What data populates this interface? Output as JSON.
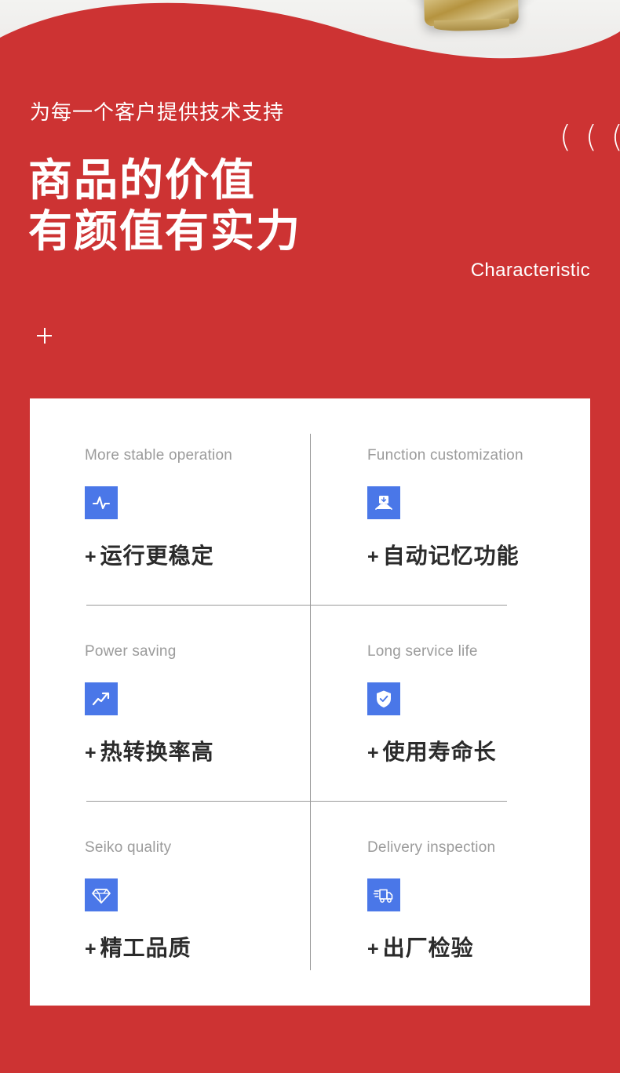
{
  "colors": {
    "brand_red": "#cd3333",
    "icon_blue": "#4a77e8",
    "card_background": "#ffffff",
    "page_background": "#eeeeee",
    "eyebrow_gray": "#9b9b9b",
    "title_dark": "#2b2b2b",
    "divider_gray": "#9a9a9a"
  },
  "header": {
    "eyebrow": "为每一个客户提供技术支持",
    "headline_line1": "商品的价值",
    "headline_line2": "有颜值有实力",
    "quote_marks": "( ( (",
    "section_label": "Characteristic",
    "plus_mark_icon": "plus-icon"
  },
  "features": {
    "items": [
      {
        "eyebrow": "More stable operation",
        "title_prefix": "+",
        "title": "运行更稳定",
        "icon": "pulse-icon"
      },
      {
        "eyebrow": "Function customization",
        "title_prefix": "+",
        "title": "自动记忆功能",
        "icon": "envelope-download-icon"
      },
      {
        "eyebrow": "Power saving",
        "title_prefix": "+",
        "title": "热转换率高",
        "icon": "trending-up-icon"
      },
      {
        "eyebrow": "Long service life",
        "title_prefix": "+",
        "title": "使用寿命长",
        "icon": "shield-check-icon"
      },
      {
        "eyebrow": "Seiko quality",
        "title_prefix": "+",
        "title": "精工品质",
        "icon": "diamond-icon"
      },
      {
        "eyebrow": "Delivery inspection",
        "title_prefix": "+",
        "title": "出厂检验",
        "icon": "delivery-truck-icon"
      }
    ]
  },
  "decor": {
    "top_photo_alt": "gold-product-fragment"
  }
}
